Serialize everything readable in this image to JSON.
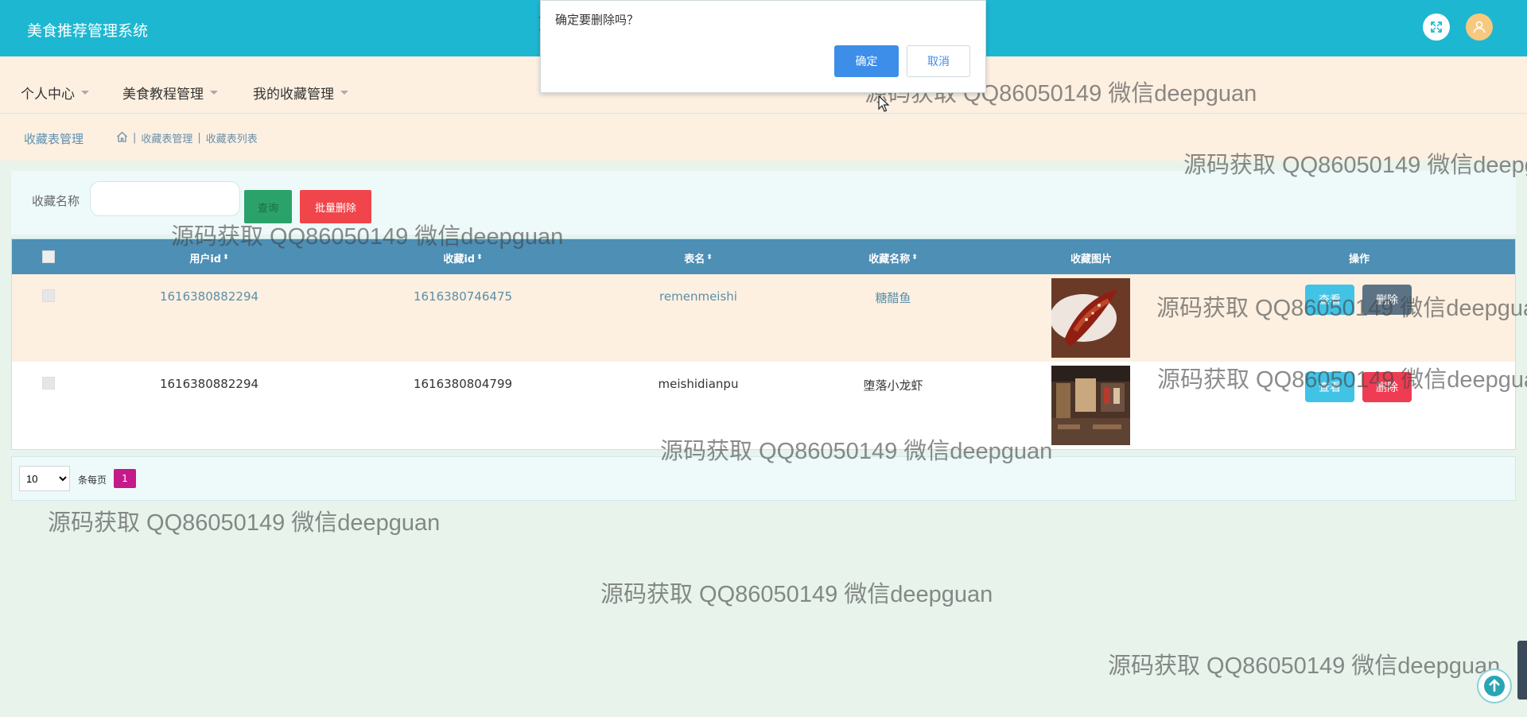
{
  "app": {
    "title": "美食推荐管理系统"
  },
  "topbar": {
    "icons": {
      "fullscreen": "fullscreen-icon",
      "avatar": "user-avatar-icon"
    },
    "colors": {
      "background": "#1eb7d1",
      "avatar": "#f7c97f"
    }
  },
  "nav": {
    "items": [
      {
        "label": "个人中心"
      },
      {
        "label": "美食教程管理"
      },
      {
        "label": "我的收藏管理"
      }
    ]
  },
  "breadcrumb": {
    "title": "收藏表管理",
    "home_icon": "home-icon",
    "items": [
      "收藏表管理",
      "收藏表列表"
    ]
  },
  "search": {
    "label": "收藏名称",
    "value": "",
    "placeholder": "",
    "search_button": "查询",
    "batch_delete_button": "批量删除"
  },
  "table": {
    "columns": [
      "用户id",
      "收藏id",
      "表名",
      "收藏名称",
      "收藏图片",
      "操作"
    ],
    "rows": [
      {
        "user_id": "1616380882294",
        "fav_id": "1616380746475",
        "table_name": "remenmeishi",
        "fav_name": "糖醋鱼",
        "view": "查看",
        "delete": "删除"
      },
      {
        "user_id": "1616380882294",
        "fav_id": "1616380804799",
        "table_name": "meishidianpu",
        "fav_name": "堕落小龙虾",
        "view": "查看",
        "delete": "删除"
      }
    ]
  },
  "pagination": {
    "page_size": "10",
    "page_size_options": [
      "10"
    ],
    "per_page_label": "条每页",
    "current_page": "1"
  },
  "dialog": {
    "message": "确定要删除吗？",
    "ok": "确定",
    "cancel": "取消"
  },
  "watermark": {
    "text": "源码获取 QQ86050149 微信deepguan"
  },
  "icons": {
    "scroll_top": "arrow-up-circle-icon",
    "cursor": "mouse-cursor-icon"
  }
}
